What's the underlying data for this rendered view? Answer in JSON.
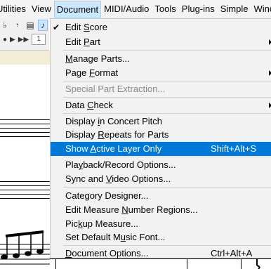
{
  "menubar": {
    "items": [
      "Utilities",
      "View",
      "Document",
      "MIDI/Audio",
      "Tools",
      "Plug-ins",
      "Simple",
      "Window"
    ],
    "active": "Document"
  },
  "toolbar": {
    "row1": [
      "♭",
      "𝄾",
      "▤",
      "♪"
    ],
    "row2_buttons": [
      "●",
      "▶",
      "▶▶"
    ],
    "row2_field": "1"
  },
  "document_menu": {
    "items": [
      {
        "pre": "Edit ",
        "u": "S",
        "post": "core",
        "checked": true,
        "check_glyph": "✔"
      },
      {
        "pre": "Edit ",
        "u": "P",
        "post": "art",
        "submenu": true
      },
      {
        "pre": "",
        "u": "M",
        "post": "anage Parts..."
      },
      {
        "pre": "Page ",
        "u": "F",
        "post": "ormat",
        "submenu": true
      },
      {
        "pre": "Special Part Extraction...",
        "u": "",
        "post": "",
        "disabled": true
      },
      {
        "pre": "Data ",
        "u": "C",
        "post": "heck",
        "submenu": true
      },
      {
        "pre": "Display ",
        "u": "i",
        "post": "n Concert Pitch"
      },
      {
        "pre": "Display ",
        "u": "R",
        "post": "epeats for Parts"
      },
      {
        "pre": "Show ",
        "u": "A",
        "post": "ctive Layer Only",
        "shortcut": "Shift+Alt+S",
        "highlighted": true
      },
      {
        "pre": "Pla",
        "u": "y",
        "post": "back/Record Options..."
      },
      {
        "pre": "Sync and ",
        "u": "V",
        "post": "ideo Options..."
      },
      {
        "pre": "Cate",
        "u": "g",
        "post": "ory Designer..."
      },
      {
        "pre": "Edit Measure ",
        "u": "N",
        "post": "umber Regions..."
      },
      {
        "pre": "Pic",
        "u": "k",
        "post": "up Measure..."
      },
      {
        "pre": "Set Default M",
        "u": "u",
        "post": "sic Font..."
      },
      {
        "pre": "",
        "u": "D",
        "post": "ocument Options...",
        "shortcut": "Ctrl+Alt+A"
      }
    ]
  },
  "colors": {
    "highlight": "#0078d7",
    "menu_bg": "#f2f2f2",
    "menubar_active": "#cce8ff",
    "score_bg": "#f3edd5"
  }
}
